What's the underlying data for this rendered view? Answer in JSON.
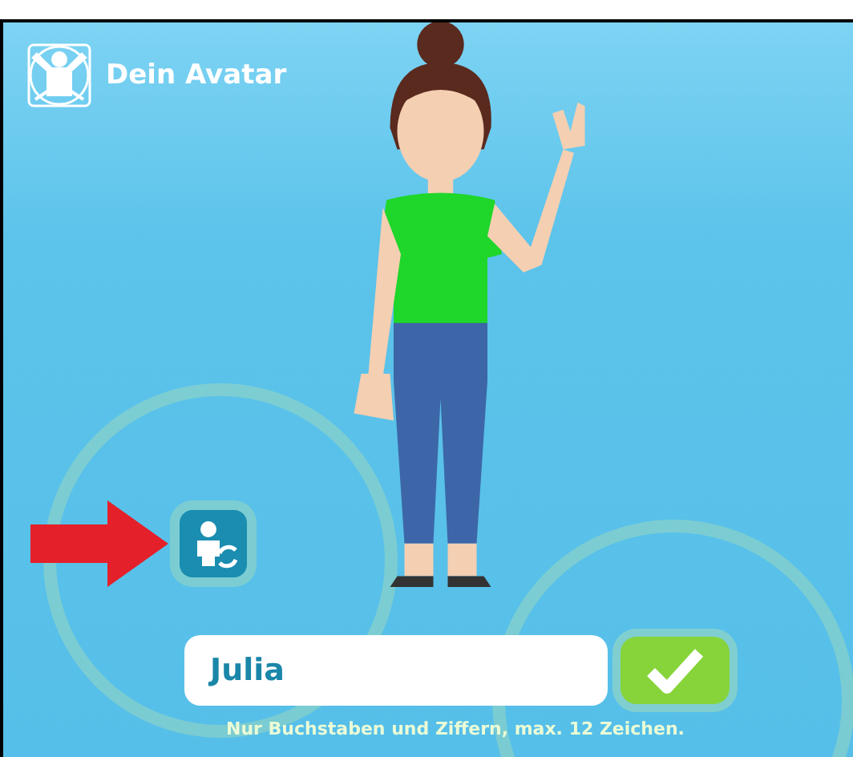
{
  "header": {
    "title": "Dein Avatar"
  },
  "name_field": {
    "value": "Julia"
  },
  "hint": "Nur Buchstaben und Ziffern, max. 12 Zeichen."
}
